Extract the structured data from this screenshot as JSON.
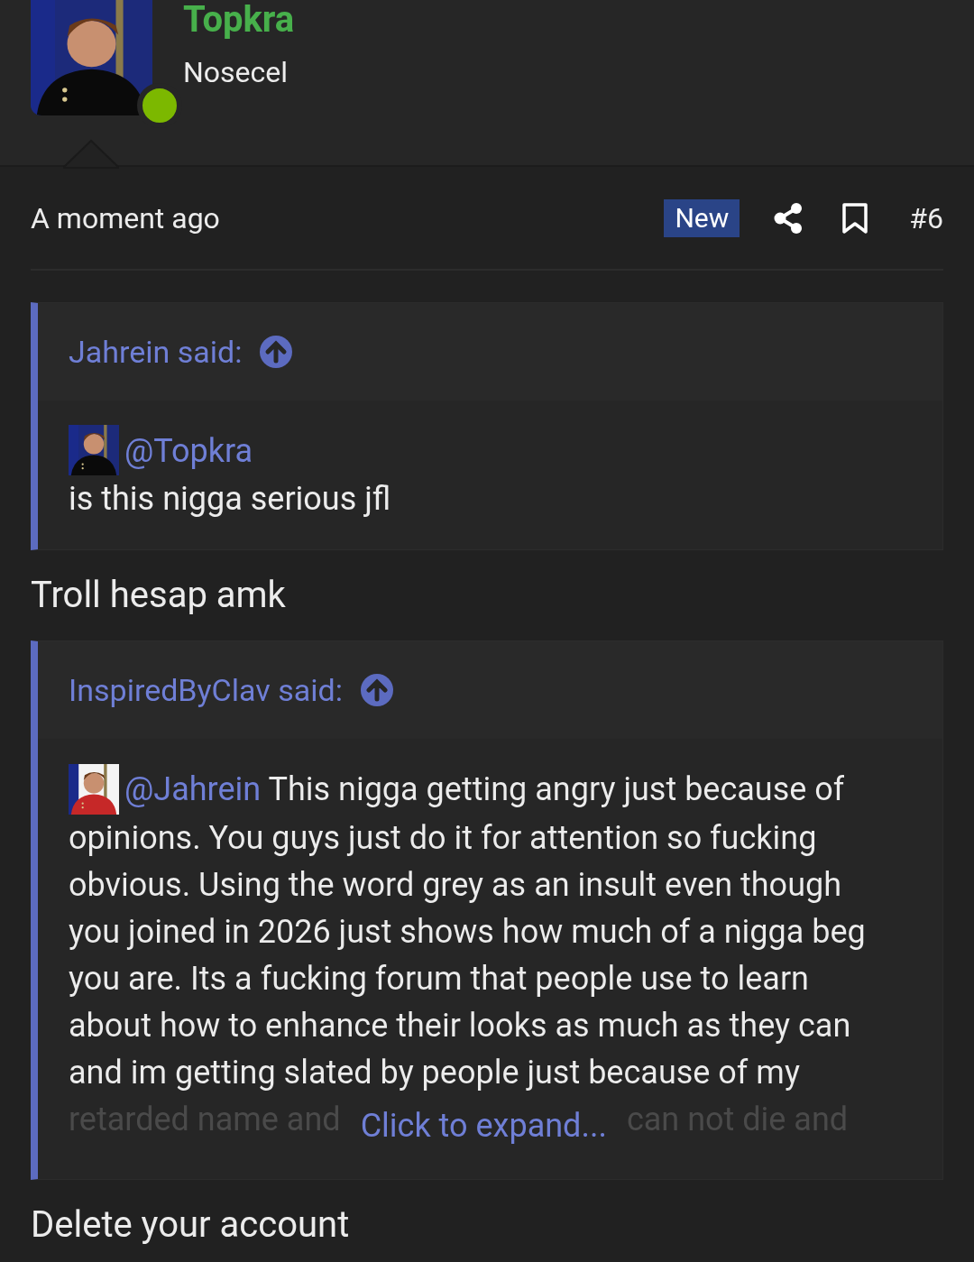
{
  "author": {
    "name": "Topkra",
    "title": "Nosecel",
    "online": true
  },
  "post": {
    "time": "A moment ago",
    "badge": "New",
    "number": "#6"
  },
  "blocks": [
    {
      "kind": "quote",
      "author": "Jahrein said:",
      "mention": "@Topkra",
      "mention_break": true,
      "text": "is this nigga serious jfl",
      "collapsed": false
    },
    {
      "kind": "text",
      "text": "Troll hesap amk"
    },
    {
      "kind": "quote",
      "author": "InspiredByClav said:",
      "mention": "@Jahrein",
      "mention_break": false,
      "text": "This nigga getting angry just because of opinions. You guys just do it for attention so fucking obvious. Using the word grey as an insult even though you joined in 2026 just shows how much of a nigga beg you are. Its a fucking forum that people use to learn about how to enhance their looks as much as they can and im getting slated by people just because of my",
      "collapsed": true,
      "hidden_left": "retarded name and",
      "hidden_right": "can not die and",
      "expand": "Click to expand..."
    },
    {
      "kind": "text",
      "text": "Delete your account"
    }
  ]
}
